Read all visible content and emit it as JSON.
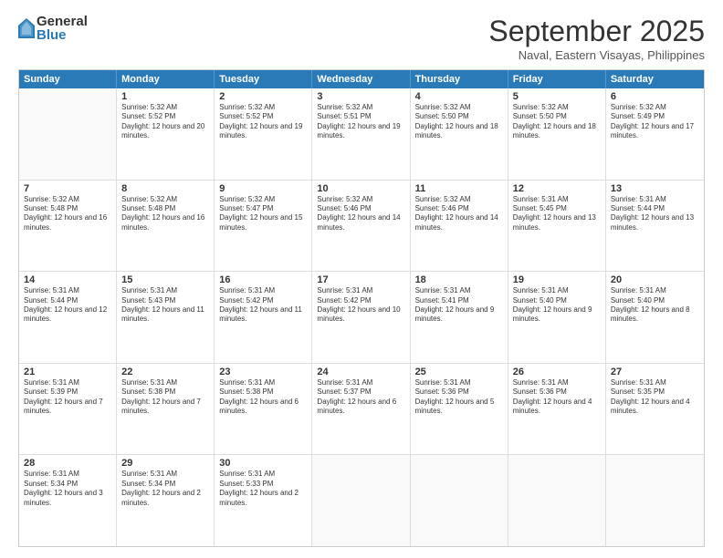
{
  "logo": {
    "general": "General",
    "blue": "Blue"
  },
  "header": {
    "month": "September 2025",
    "location": "Naval, Eastern Visayas, Philippines"
  },
  "weekdays": [
    "Sunday",
    "Monday",
    "Tuesday",
    "Wednesday",
    "Thursday",
    "Friday",
    "Saturday"
  ],
  "rows": [
    [
      {
        "day": "",
        "empty": true
      },
      {
        "day": "1",
        "sunrise": "Sunrise: 5:32 AM",
        "sunset": "Sunset: 5:52 PM",
        "daylight": "Daylight: 12 hours and 20 minutes."
      },
      {
        "day": "2",
        "sunrise": "Sunrise: 5:32 AM",
        "sunset": "Sunset: 5:52 PM",
        "daylight": "Daylight: 12 hours and 19 minutes."
      },
      {
        "day": "3",
        "sunrise": "Sunrise: 5:32 AM",
        "sunset": "Sunset: 5:51 PM",
        "daylight": "Daylight: 12 hours and 19 minutes."
      },
      {
        "day": "4",
        "sunrise": "Sunrise: 5:32 AM",
        "sunset": "Sunset: 5:50 PM",
        "daylight": "Daylight: 12 hours and 18 minutes."
      },
      {
        "day": "5",
        "sunrise": "Sunrise: 5:32 AM",
        "sunset": "Sunset: 5:50 PM",
        "daylight": "Daylight: 12 hours and 18 minutes."
      },
      {
        "day": "6",
        "sunrise": "Sunrise: 5:32 AM",
        "sunset": "Sunset: 5:49 PM",
        "daylight": "Daylight: 12 hours and 17 minutes."
      }
    ],
    [
      {
        "day": "7",
        "sunrise": "Sunrise: 5:32 AM",
        "sunset": "Sunset: 5:48 PM",
        "daylight": "Daylight: 12 hours and 16 minutes."
      },
      {
        "day": "8",
        "sunrise": "Sunrise: 5:32 AM",
        "sunset": "Sunset: 5:48 PM",
        "daylight": "Daylight: 12 hours and 16 minutes."
      },
      {
        "day": "9",
        "sunrise": "Sunrise: 5:32 AM",
        "sunset": "Sunset: 5:47 PM",
        "daylight": "Daylight: 12 hours and 15 minutes."
      },
      {
        "day": "10",
        "sunrise": "Sunrise: 5:32 AM",
        "sunset": "Sunset: 5:46 PM",
        "daylight": "Daylight: 12 hours and 14 minutes."
      },
      {
        "day": "11",
        "sunrise": "Sunrise: 5:32 AM",
        "sunset": "Sunset: 5:46 PM",
        "daylight": "Daylight: 12 hours and 14 minutes."
      },
      {
        "day": "12",
        "sunrise": "Sunrise: 5:31 AM",
        "sunset": "Sunset: 5:45 PM",
        "daylight": "Daylight: 12 hours and 13 minutes."
      },
      {
        "day": "13",
        "sunrise": "Sunrise: 5:31 AM",
        "sunset": "Sunset: 5:44 PM",
        "daylight": "Daylight: 12 hours and 13 minutes."
      }
    ],
    [
      {
        "day": "14",
        "sunrise": "Sunrise: 5:31 AM",
        "sunset": "Sunset: 5:44 PM",
        "daylight": "Daylight: 12 hours and 12 minutes."
      },
      {
        "day": "15",
        "sunrise": "Sunrise: 5:31 AM",
        "sunset": "Sunset: 5:43 PM",
        "daylight": "Daylight: 12 hours and 11 minutes."
      },
      {
        "day": "16",
        "sunrise": "Sunrise: 5:31 AM",
        "sunset": "Sunset: 5:42 PM",
        "daylight": "Daylight: 12 hours and 11 minutes."
      },
      {
        "day": "17",
        "sunrise": "Sunrise: 5:31 AM",
        "sunset": "Sunset: 5:42 PM",
        "daylight": "Daylight: 12 hours and 10 minutes."
      },
      {
        "day": "18",
        "sunrise": "Sunrise: 5:31 AM",
        "sunset": "Sunset: 5:41 PM",
        "daylight": "Daylight: 12 hours and 9 minutes."
      },
      {
        "day": "19",
        "sunrise": "Sunrise: 5:31 AM",
        "sunset": "Sunset: 5:40 PM",
        "daylight": "Daylight: 12 hours and 9 minutes."
      },
      {
        "day": "20",
        "sunrise": "Sunrise: 5:31 AM",
        "sunset": "Sunset: 5:40 PM",
        "daylight": "Daylight: 12 hours and 8 minutes."
      }
    ],
    [
      {
        "day": "21",
        "sunrise": "Sunrise: 5:31 AM",
        "sunset": "Sunset: 5:39 PM",
        "daylight": "Daylight: 12 hours and 7 minutes."
      },
      {
        "day": "22",
        "sunrise": "Sunrise: 5:31 AM",
        "sunset": "Sunset: 5:38 PM",
        "daylight": "Daylight: 12 hours and 7 minutes."
      },
      {
        "day": "23",
        "sunrise": "Sunrise: 5:31 AM",
        "sunset": "Sunset: 5:38 PM",
        "daylight": "Daylight: 12 hours and 6 minutes."
      },
      {
        "day": "24",
        "sunrise": "Sunrise: 5:31 AM",
        "sunset": "Sunset: 5:37 PM",
        "daylight": "Daylight: 12 hours and 6 minutes."
      },
      {
        "day": "25",
        "sunrise": "Sunrise: 5:31 AM",
        "sunset": "Sunset: 5:36 PM",
        "daylight": "Daylight: 12 hours and 5 minutes."
      },
      {
        "day": "26",
        "sunrise": "Sunrise: 5:31 AM",
        "sunset": "Sunset: 5:36 PM",
        "daylight": "Daylight: 12 hours and 4 minutes."
      },
      {
        "day": "27",
        "sunrise": "Sunrise: 5:31 AM",
        "sunset": "Sunset: 5:35 PM",
        "daylight": "Daylight: 12 hours and 4 minutes."
      }
    ],
    [
      {
        "day": "28",
        "sunrise": "Sunrise: 5:31 AM",
        "sunset": "Sunset: 5:34 PM",
        "daylight": "Daylight: 12 hours and 3 minutes."
      },
      {
        "day": "29",
        "sunrise": "Sunrise: 5:31 AM",
        "sunset": "Sunset: 5:34 PM",
        "daylight": "Daylight: 12 hours and 2 minutes."
      },
      {
        "day": "30",
        "sunrise": "Sunrise: 5:31 AM",
        "sunset": "Sunset: 5:33 PM",
        "daylight": "Daylight: 12 hours and 2 minutes."
      },
      {
        "day": "",
        "empty": true
      },
      {
        "day": "",
        "empty": true
      },
      {
        "day": "",
        "empty": true
      },
      {
        "day": "",
        "empty": true
      }
    ]
  ]
}
